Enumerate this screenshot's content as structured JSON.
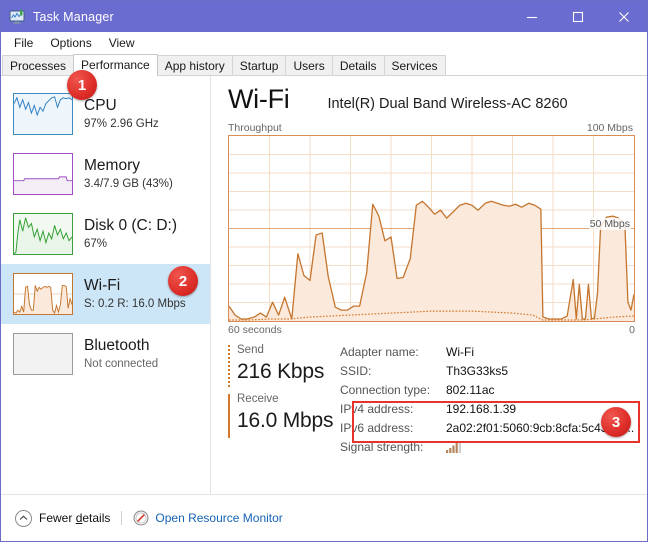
{
  "window": {
    "title": "Task Manager",
    "icon": "task-manager-icon",
    "minimize": "–",
    "maximize": "□",
    "close": "✕",
    "accent_color": "#6b6cd0"
  },
  "menu": {
    "items": [
      "File",
      "Options",
      "View"
    ]
  },
  "tabs": {
    "items": [
      {
        "label": "Processes",
        "active": false
      },
      {
        "label": "Performance",
        "active": true
      },
      {
        "label": "App history",
        "active": false
      },
      {
        "label": "Startup",
        "active": false
      },
      {
        "label": "Users",
        "active": false
      },
      {
        "label": "Details",
        "active": false
      },
      {
        "label": "Services",
        "active": false
      }
    ]
  },
  "sidebar": {
    "items": [
      {
        "title": "CPU",
        "subtitle": "97%  2.96 GHz",
        "selected": false,
        "accent": "#4a90c4"
      },
      {
        "title": "Memory",
        "subtitle": "3.4/7.9 GB (43%)",
        "selected": false,
        "accent": "#a04ec2"
      },
      {
        "title": "Disk 0 (C: D:)",
        "subtitle": "67%",
        "selected": false,
        "accent": "#4aab4a"
      },
      {
        "title": "Wi-Fi",
        "subtitle": "S: 0.2 R: 16.0 Mbps",
        "selected": true,
        "accent": "#c4762f"
      },
      {
        "title": "Bluetooth",
        "subtitle": "Not connected",
        "selected": false,
        "accent": "#9a9a9a"
      }
    ]
  },
  "main": {
    "title": "Wi-Fi",
    "adapter_model": "Intel(R) Dual Band Wireless-AC 8260",
    "chart_label": "Throughput",
    "chart_max": "100 Mbps",
    "chart_mid": "50 Mbps",
    "chart_time": "60 seconds",
    "chart_zero": "0"
  },
  "send": {
    "label": "Send",
    "value": "216 Kbps"
  },
  "receive": {
    "label": "Receive",
    "value": "16.0 Mbps"
  },
  "adapter_info": {
    "rows": [
      {
        "key": "Adapter name:",
        "value": "Wi-Fi"
      },
      {
        "key": "SSID:",
        "value": "Th3G33ks5"
      },
      {
        "key": "Connection type:",
        "value": "802.11ac"
      },
      {
        "key": "IPv4 address:",
        "value": "192.168.1.39"
      },
      {
        "key": "IPv6 address:",
        "value": "2a02:2f01:5060:9cb:8cfa:5c43:1a..."
      }
    ],
    "signal_key": "Signal strength:",
    "signal_icon": "signal-bars-icon"
  },
  "statusbar": {
    "chevron_icon": "chevron-up-icon",
    "fewer_details_pre": "Fewer ",
    "fewer_details_underlined": "d",
    "fewer_details_post": "etails",
    "monitor_icon": "resource-monitor-icon",
    "open_resource_monitor": "Open Resource Monitor",
    "link_color": "#1763b5"
  },
  "callouts": [
    {
      "number": "1"
    },
    {
      "number": "2"
    },
    {
      "number": "3"
    }
  ],
  "chart_data": {
    "type": "area",
    "title": "Throughput",
    "xlabel": "60 seconds",
    "ylabel": "Mbps",
    "ylim": [
      0,
      100
    ],
    "xlim": [
      0,
      60
    ],
    "grid": true,
    "legend_position": "none",
    "annotations": [
      "100 Mbps",
      "50 Mbps",
      "0",
      "60 seconds"
    ],
    "series": [
      {
        "name": "Receive",
        "color": "#c4762f",
        "fill": "#fbe9dc",
        "values": [
          8,
          3,
          1,
          1,
          2,
          4,
          2,
          7,
          3,
          13,
          1,
          36,
          56,
          54,
          20,
          9,
          7,
          7,
          8,
          8,
          26,
          63,
          49,
          46,
          22,
          13,
          33,
          57,
          57,
          53,
          54,
          52,
          51,
          48,
          52,
          55,
          56,
          55,
          52,
          55,
          56,
          54,
          52,
          54,
          52,
          53,
          1,
          1,
          1,
          13,
          2,
          14,
          1,
          1,
          48,
          55,
          55,
          54,
          22,
          6,
          13,
          18,
          8,
          6,
          10
        ]
      },
      {
        "name": "Send",
        "color": "#d4792a",
        "style": "dotted",
        "values": [
          1,
          1,
          1,
          1,
          1,
          1,
          1,
          1,
          1,
          1,
          1,
          2,
          2,
          2,
          2,
          2,
          2,
          2,
          2,
          2,
          3,
          3,
          3,
          3,
          3,
          3,
          4,
          4,
          4,
          4,
          4,
          4,
          4,
          4,
          4,
          4,
          4,
          4,
          3,
          3,
          3,
          3,
          3,
          3,
          2,
          2,
          1,
          1,
          1,
          1,
          1,
          1,
          1,
          1,
          2,
          2,
          2,
          2,
          2,
          2,
          2,
          2,
          2,
          2,
          2
        ]
      }
    ]
  }
}
